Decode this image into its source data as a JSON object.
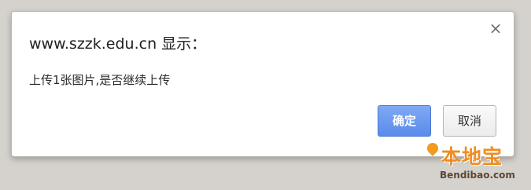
{
  "dialog": {
    "title": "www.szzk.edu.cn 显示：",
    "close_glyph": "×",
    "message": "上传1张图片,是否继续上传",
    "ok_label": "确定",
    "cancel_label": "取消"
  },
  "watermark": {
    "main_text": "本地宝",
    "sub_text": "Bendibao.com",
    "icon": "map-pin-icon"
  },
  "colors": {
    "background": "#d5d2cd",
    "ok_button": "#5a8be9",
    "watermark_orange": "#ef8d22"
  }
}
